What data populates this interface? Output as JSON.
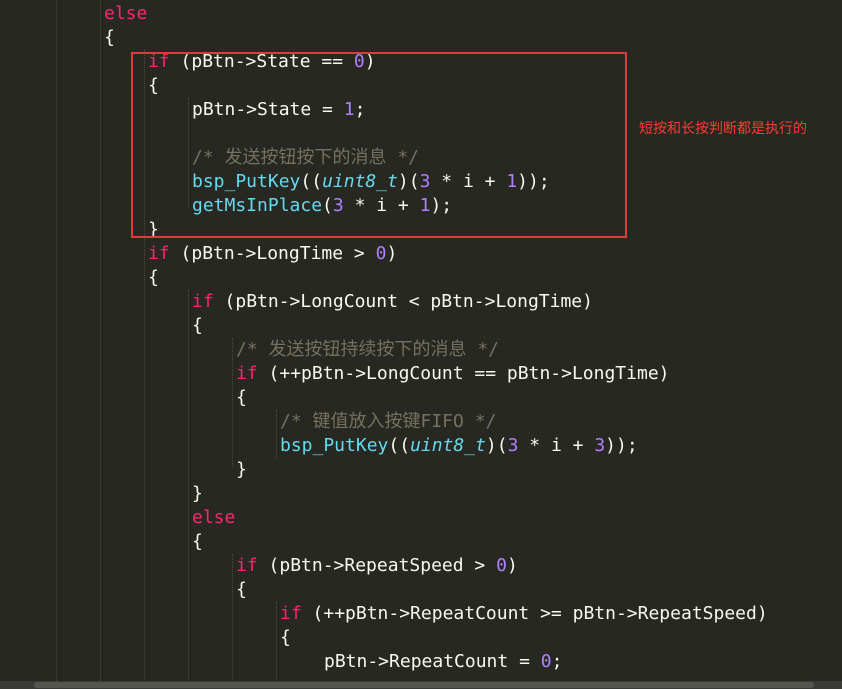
{
  "annotation": {
    "text": "短按和长按判断都是执行的",
    "color": "#ff3b30"
  },
  "highlight": {
    "color": "#e53935"
  },
  "code_lines": [
    [
      {
        "t": "else",
        "c": "kw"
      }
    ],
    [
      {
        "t": "{",
        "c": ""
      }
    ],
    [
      {
        "t": "if",
        "c": "kw"
      },
      {
        "t": " (pBtn->State == ",
        "c": ""
      },
      {
        "t": "0",
        "c": "num"
      },
      {
        "t": ")",
        "c": ""
      }
    ],
    [
      {
        "t": "{",
        "c": ""
      }
    ],
    [
      {
        "t": "pBtn->State = ",
        "c": ""
      },
      {
        "t": "1",
        "c": "num"
      },
      {
        "t": ";",
        "c": ""
      }
    ],
    [],
    [
      {
        "t": "/* 发送按钮按下的消息 */",
        "c": "comment"
      }
    ],
    [
      {
        "t": "bsp_PutKey",
        "c": "fn"
      },
      {
        "t": "((",
        "c": ""
      },
      {
        "t": "uint8_t",
        "c": "type"
      },
      {
        "t": ")(",
        "c": ""
      },
      {
        "t": "3",
        "c": "num"
      },
      {
        "t": " * i + ",
        "c": ""
      },
      {
        "t": "1",
        "c": "num"
      },
      {
        "t": "));",
        "c": ""
      }
    ],
    [
      {
        "t": "getMsInPlace",
        "c": "fn"
      },
      {
        "t": "(",
        "c": ""
      },
      {
        "t": "3",
        "c": "num"
      },
      {
        "t": " * i + ",
        "c": ""
      },
      {
        "t": "1",
        "c": "num"
      },
      {
        "t": ");",
        "c": ""
      }
    ],
    [
      {
        "t": "}",
        "c": ""
      }
    ],
    [
      {
        "t": "if",
        "c": "kw"
      },
      {
        "t": " (pBtn->LongTime > ",
        "c": ""
      },
      {
        "t": "0",
        "c": "num"
      },
      {
        "t": ")",
        "c": ""
      }
    ],
    [
      {
        "t": "{",
        "c": ""
      }
    ],
    [
      {
        "t": "if",
        "c": "kw"
      },
      {
        "t": " (pBtn->LongCount < pBtn->LongTime)",
        "c": ""
      }
    ],
    [
      {
        "t": "{",
        "c": ""
      }
    ],
    [
      {
        "t": "/* 发送按钮持续按下的消息 */",
        "c": "comment"
      }
    ],
    [
      {
        "t": "if",
        "c": "kw"
      },
      {
        "t": " (++pBtn->LongCount == pBtn->LongTime)",
        "c": ""
      }
    ],
    [
      {
        "t": "{",
        "c": ""
      }
    ],
    [
      {
        "t": "/* 键值放入按键FIFO */",
        "c": "comment"
      }
    ],
    [
      {
        "t": "bsp_PutKey",
        "c": "fn"
      },
      {
        "t": "((",
        "c": ""
      },
      {
        "t": "uint8_t",
        "c": "type"
      },
      {
        "t": ")(",
        "c": ""
      },
      {
        "t": "3",
        "c": "num"
      },
      {
        "t": " * i + ",
        "c": ""
      },
      {
        "t": "3",
        "c": "num"
      },
      {
        "t": "));",
        "c": ""
      }
    ],
    [
      {
        "t": "}",
        "c": ""
      }
    ],
    [
      {
        "t": "}",
        "c": ""
      }
    ],
    [
      {
        "t": "else",
        "c": "kw"
      }
    ],
    [
      {
        "t": "{",
        "c": ""
      }
    ],
    [
      {
        "t": "if",
        "c": "kw"
      },
      {
        "t": " (pBtn->RepeatSpeed > ",
        "c": ""
      },
      {
        "t": "0",
        "c": "num"
      },
      {
        "t": ")",
        "c": ""
      }
    ],
    [
      {
        "t": "{",
        "c": ""
      }
    ],
    [
      {
        "t": "if",
        "c": "kw"
      },
      {
        "t": " (++pBtn->RepeatCount >= pBtn->RepeatSpeed)",
        "c": ""
      }
    ],
    [
      {
        "t": "{",
        "c": ""
      }
    ],
    [
      {
        "t": "pBtn->RepeatCount = ",
        "c": ""
      },
      {
        "t": "0",
        "c": "num"
      },
      {
        "t": ";",
        "c": ""
      }
    ]
  ]
}
